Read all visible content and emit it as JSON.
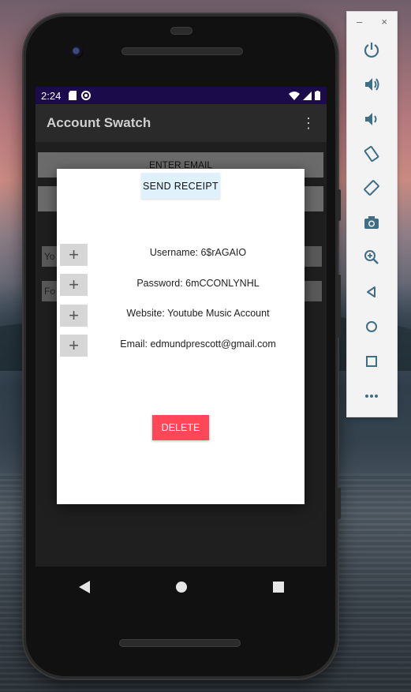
{
  "status_bar": {
    "time": "2:24"
  },
  "app_bar": {
    "title": "Account Swatch",
    "menu_icon": "more-vert-icon"
  },
  "background_screen": {
    "enter_email_label": "ENTER EMAIL",
    "input1_partial": "Yo",
    "input2_partial": "Fo"
  },
  "dialog": {
    "send_receipt_label": "SEND RECEIPT",
    "add_label": "+",
    "fields": [
      {
        "text": "Username: 6$rAGAIO"
      },
      {
        "text": "Password: 6mCCONLYNHL"
      },
      {
        "text": "Website: Youtube Music Account"
      },
      {
        "text": "Email: edmundprescott@gmail.com"
      }
    ],
    "delete_label": "DELETE"
  },
  "emulator_panel": {
    "minimize_label": "–",
    "close_label": "×",
    "controls": [
      "power-icon",
      "volume-up-icon",
      "volume-down-icon",
      "rotate-left-icon",
      "rotate-right-icon",
      "camera-icon",
      "zoom-icon",
      "back-icon",
      "home-icon",
      "overview-icon",
      "more-icon"
    ]
  },
  "colors": {
    "status_bar": "#1b0b4a",
    "send_receipt_bg": "#dff1fb",
    "delete_bg": "#ff4757"
  }
}
